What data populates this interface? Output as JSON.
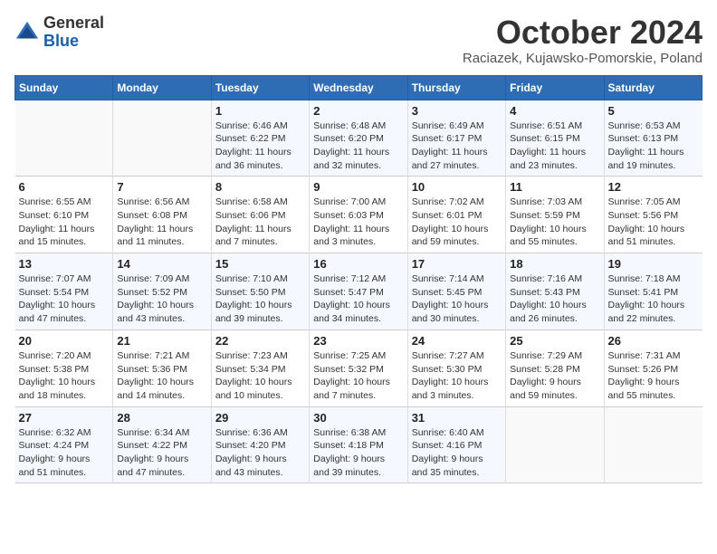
{
  "header": {
    "logo_line1": "General",
    "logo_line2": "Blue",
    "month": "October 2024",
    "location": "Raciazek, Kujawsko-Pomorskie, Poland"
  },
  "weekdays": [
    "Sunday",
    "Monday",
    "Tuesday",
    "Wednesday",
    "Thursday",
    "Friday",
    "Saturday"
  ],
  "weeks": [
    [
      {
        "day": "",
        "info": ""
      },
      {
        "day": "",
        "info": ""
      },
      {
        "day": "1",
        "info": "Sunrise: 6:46 AM\nSunset: 6:22 PM\nDaylight: 11 hours\nand 36 minutes."
      },
      {
        "day": "2",
        "info": "Sunrise: 6:48 AM\nSunset: 6:20 PM\nDaylight: 11 hours\nand 32 minutes."
      },
      {
        "day": "3",
        "info": "Sunrise: 6:49 AM\nSunset: 6:17 PM\nDaylight: 11 hours\nand 27 minutes."
      },
      {
        "day": "4",
        "info": "Sunrise: 6:51 AM\nSunset: 6:15 PM\nDaylight: 11 hours\nand 23 minutes."
      },
      {
        "day": "5",
        "info": "Sunrise: 6:53 AM\nSunset: 6:13 PM\nDaylight: 11 hours\nand 19 minutes."
      }
    ],
    [
      {
        "day": "6",
        "info": "Sunrise: 6:55 AM\nSunset: 6:10 PM\nDaylight: 11 hours\nand 15 minutes."
      },
      {
        "day": "7",
        "info": "Sunrise: 6:56 AM\nSunset: 6:08 PM\nDaylight: 11 hours\nand 11 minutes."
      },
      {
        "day": "8",
        "info": "Sunrise: 6:58 AM\nSunset: 6:06 PM\nDaylight: 11 hours\nand 7 minutes."
      },
      {
        "day": "9",
        "info": "Sunrise: 7:00 AM\nSunset: 6:03 PM\nDaylight: 11 hours\nand 3 minutes."
      },
      {
        "day": "10",
        "info": "Sunrise: 7:02 AM\nSunset: 6:01 PM\nDaylight: 10 hours\nand 59 minutes."
      },
      {
        "day": "11",
        "info": "Sunrise: 7:03 AM\nSunset: 5:59 PM\nDaylight: 10 hours\nand 55 minutes."
      },
      {
        "day": "12",
        "info": "Sunrise: 7:05 AM\nSunset: 5:56 PM\nDaylight: 10 hours\nand 51 minutes."
      }
    ],
    [
      {
        "day": "13",
        "info": "Sunrise: 7:07 AM\nSunset: 5:54 PM\nDaylight: 10 hours\nand 47 minutes."
      },
      {
        "day": "14",
        "info": "Sunrise: 7:09 AM\nSunset: 5:52 PM\nDaylight: 10 hours\nand 43 minutes."
      },
      {
        "day": "15",
        "info": "Sunrise: 7:10 AM\nSunset: 5:50 PM\nDaylight: 10 hours\nand 39 minutes."
      },
      {
        "day": "16",
        "info": "Sunrise: 7:12 AM\nSunset: 5:47 PM\nDaylight: 10 hours\nand 34 minutes."
      },
      {
        "day": "17",
        "info": "Sunrise: 7:14 AM\nSunset: 5:45 PM\nDaylight: 10 hours\nand 30 minutes."
      },
      {
        "day": "18",
        "info": "Sunrise: 7:16 AM\nSunset: 5:43 PM\nDaylight: 10 hours\nand 26 minutes."
      },
      {
        "day": "19",
        "info": "Sunrise: 7:18 AM\nSunset: 5:41 PM\nDaylight: 10 hours\nand 22 minutes."
      }
    ],
    [
      {
        "day": "20",
        "info": "Sunrise: 7:20 AM\nSunset: 5:38 PM\nDaylight: 10 hours\nand 18 minutes."
      },
      {
        "day": "21",
        "info": "Sunrise: 7:21 AM\nSunset: 5:36 PM\nDaylight: 10 hours\nand 14 minutes."
      },
      {
        "day": "22",
        "info": "Sunrise: 7:23 AM\nSunset: 5:34 PM\nDaylight: 10 hours\nand 10 minutes."
      },
      {
        "day": "23",
        "info": "Sunrise: 7:25 AM\nSunset: 5:32 PM\nDaylight: 10 hours\nand 7 minutes."
      },
      {
        "day": "24",
        "info": "Sunrise: 7:27 AM\nSunset: 5:30 PM\nDaylight: 10 hours\nand 3 minutes."
      },
      {
        "day": "25",
        "info": "Sunrise: 7:29 AM\nSunset: 5:28 PM\nDaylight: 9 hours\nand 59 minutes."
      },
      {
        "day": "26",
        "info": "Sunrise: 7:31 AM\nSunset: 5:26 PM\nDaylight: 9 hours\nand 55 minutes."
      }
    ],
    [
      {
        "day": "27",
        "info": "Sunrise: 6:32 AM\nSunset: 4:24 PM\nDaylight: 9 hours\nand 51 minutes."
      },
      {
        "day": "28",
        "info": "Sunrise: 6:34 AM\nSunset: 4:22 PM\nDaylight: 9 hours\nand 47 minutes."
      },
      {
        "day": "29",
        "info": "Sunrise: 6:36 AM\nSunset: 4:20 PM\nDaylight: 9 hours\nand 43 minutes."
      },
      {
        "day": "30",
        "info": "Sunrise: 6:38 AM\nSunset: 4:18 PM\nDaylight: 9 hours\nand 39 minutes."
      },
      {
        "day": "31",
        "info": "Sunrise: 6:40 AM\nSunset: 4:16 PM\nDaylight: 9 hours\nand 35 minutes."
      },
      {
        "day": "",
        "info": ""
      },
      {
        "day": "",
        "info": ""
      }
    ]
  ]
}
